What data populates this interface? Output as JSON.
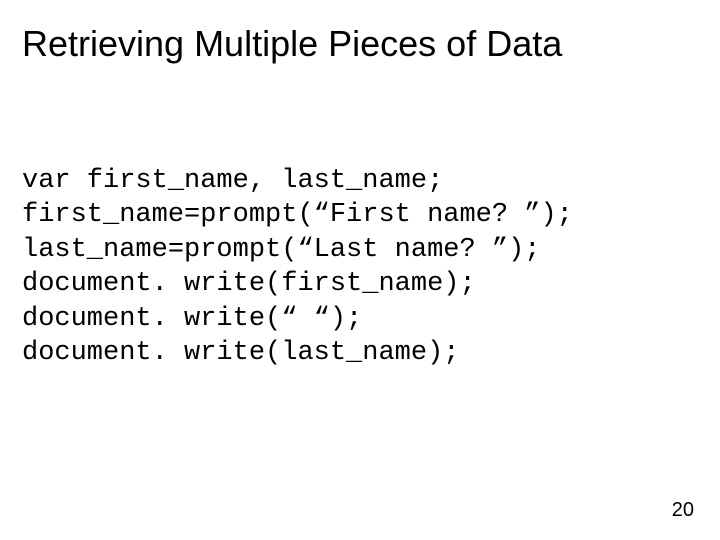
{
  "slide": {
    "title": "Retrieving Multiple Pieces of Data",
    "code_lines": {
      "l0": "var first_name, last_name;",
      "l1": "first_name=prompt(“First name? ”);",
      "l2": "last_name=prompt(“Last name? ”);",
      "l3": "document. write(first_name);",
      "l4": "document. write(“ “);",
      "l5": "document. write(last_name);"
    },
    "page_number": "20"
  }
}
